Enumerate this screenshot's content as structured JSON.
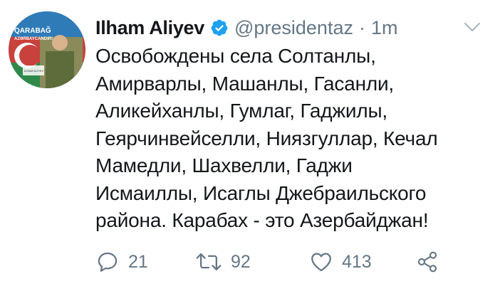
{
  "tweet": {
    "author_name": "Ilham Aliyev",
    "handle": "@presidentaz",
    "separator": "·",
    "time": "1m",
    "text": "Освобождены села Солтанлы,\nАмирварлы, Машанлы, Гасанли,\nАликейханлы, Гумлаг, Гаджилы,\nГеярчинвейселли, Ниязгуллар, Кечал\nМамедли, Шахвелли, Гаджи\nИсмаиллы, Исаглы Джебраильского\nрайона. Карабах - это Азербайджан!",
    "avatar": {
      "banner_line1": "QARABAĞ",
      "banner_line2": "AZƏRBAYCANDIR!",
      "badge": "İLHAM ALİYEV"
    },
    "actions": {
      "replies": "21",
      "retweets": "92",
      "likes": "413"
    }
  },
  "colors": {
    "text": "#14171a",
    "secondary": "#657786",
    "verified": "#1da1f2"
  },
  "icons": [
    "verified-badge-icon",
    "chevron-down-icon",
    "reply-icon",
    "retweet-icon",
    "like-icon",
    "share-icon"
  ]
}
